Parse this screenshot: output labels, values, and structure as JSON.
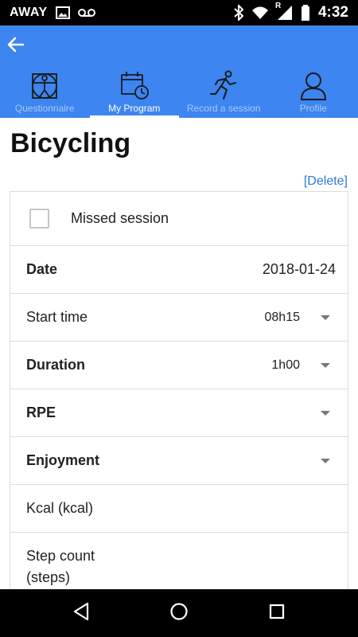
{
  "status_bar": {
    "carrier_label": "AWAY",
    "roaming_indicator": "R",
    "time": "4:32",
    "icons": [
      "image-icon",
      "voicemail-icon",
      "bluetooth-icon",
      "wifi-icon",
      "signal-icon",
      "battery-icon"
    ]
  },
  "header": {
    "back_icon": "arrow-back-icon",
    "tabs": [
      {
        "label": "Questionnaire",
        "icon": "vitruvian-man-icon",
        "active": false
      },
      {
        "label": "My Program",
        "icon": "calendar-clock-icon",
        "active": true
      },
      {
        "label": "Record a session",
        "icon": "running-man-icon",
        "active": false
      },
      {
        "label": "Profile",
        "icon": "person-icon",
        "active": false
      }
    ],
    "color": "#3D85F0"
  },
  "page": {
    "title": "Bicycling",
    "delete_label": "[Delete]"
  },
  "form": {
    "missed_session": {
      "label": "Missed session",
      "checked": false
    },
    "date": {
      "label": "Date",
      "value": "2018-01-24"
    },
    "start_time": {
      "label": "Start time",
      "value": "08h15"
    },
    "duration": {
      "label": "Duration",
      "value": "1h00"
    },
    "rpe": {
      "label": "RPE",
      "value": ""
    },
    "enjoyment": {
      "label": "Enjoyment",
      "value": ""
    },
    "kcal": {
      "label": "Kcal (kcal)"
    },
    "step_count": {
      "label_line1": "Step count",
      "label_line2": "(steps)"
    }
  },
  "nav_bar": {
    "buttons": [
      "back-triangle-icon",
      "home-circle-icon",
      "recents-square-icon"
    ]
  }
}
